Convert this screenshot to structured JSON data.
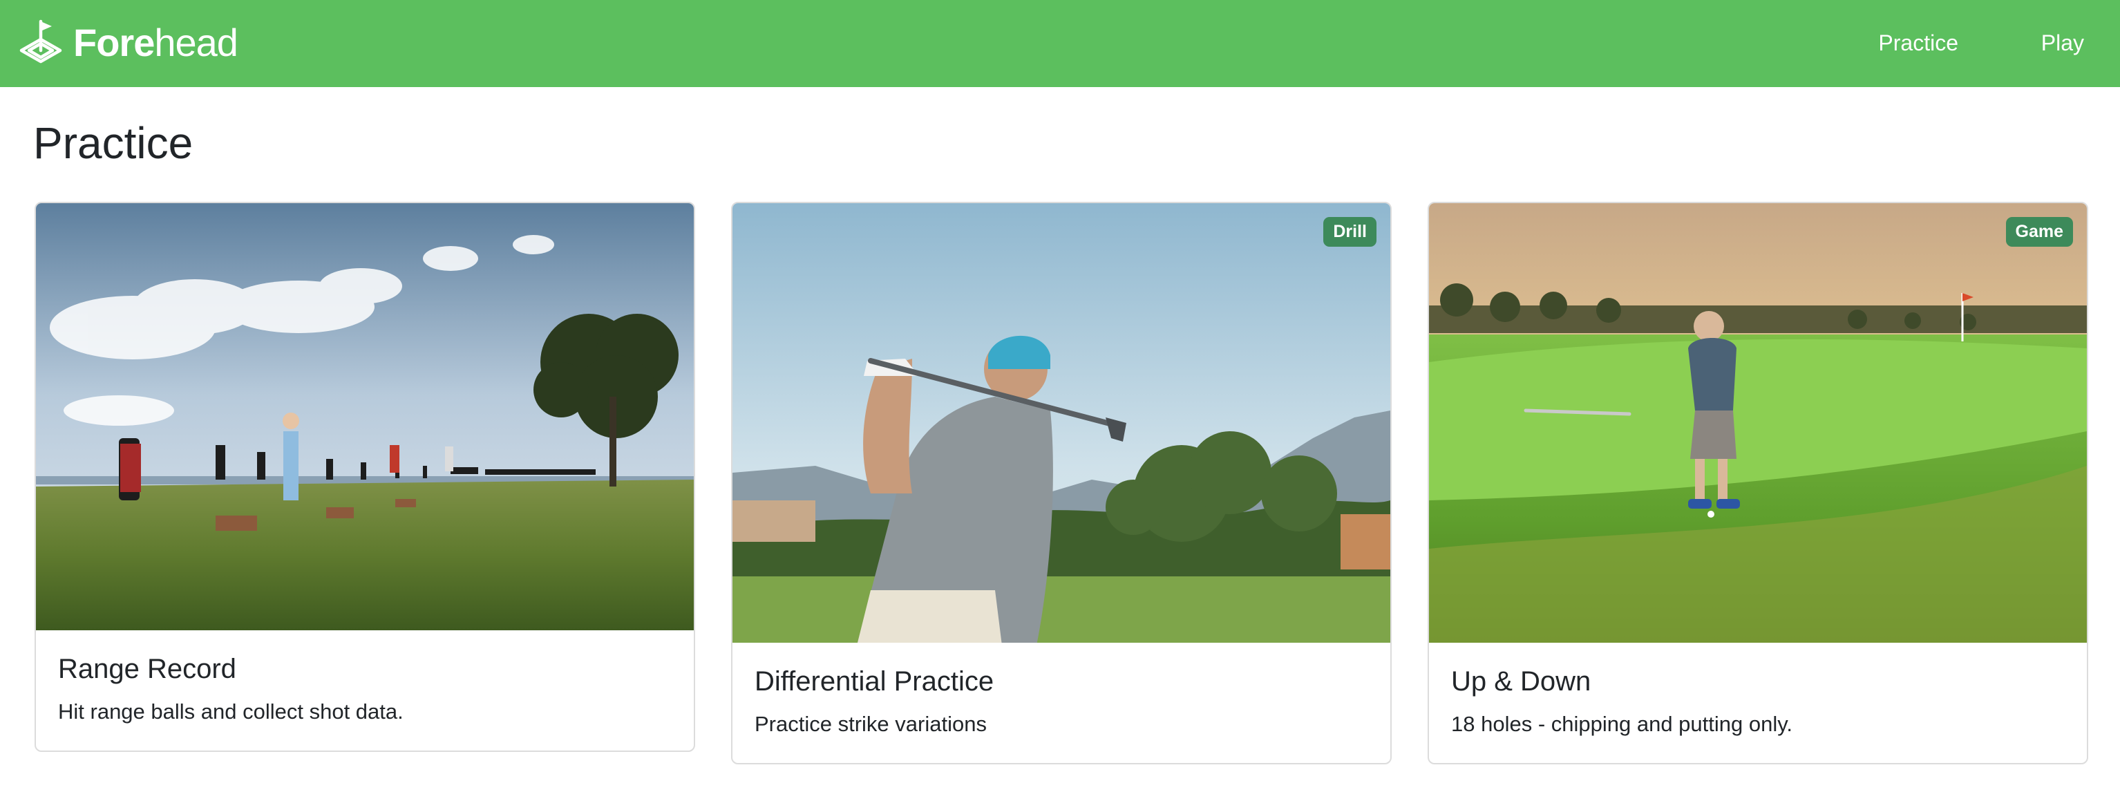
{
  "navbar": {
    "brand_bold": "Fore",
    "brand_light": "head",
    "links": [
      {
        "label": "Practice"
      },
      {
        "label": "Play"
      }
    ],
    "background_color": "#5cbf5e"
  },
  "page": {
    "title": "Practice"
  },
  "cards": [
    {
      "title": "Range Record",
      "text": "Hit range balls and collect shot data.",
      "badge": null,
      "image": "driving-range-photo"
    },
    {
      "title": "Differential Practice",
      "text": "Practice strike variations",
      "badge": "Drill",
      "image": "golfer-swing-photo"
    },
    {
      "title": "Up & Down",
      "text": "18 holes - chipping and putting only.",
      "badge": "Game",
      "image": "golfer-chipping-photo"
    }
  ],
  "colors": {
    "badge": "#3d8a5a",
    "card_border": "#dcdcdc"
  }
}
